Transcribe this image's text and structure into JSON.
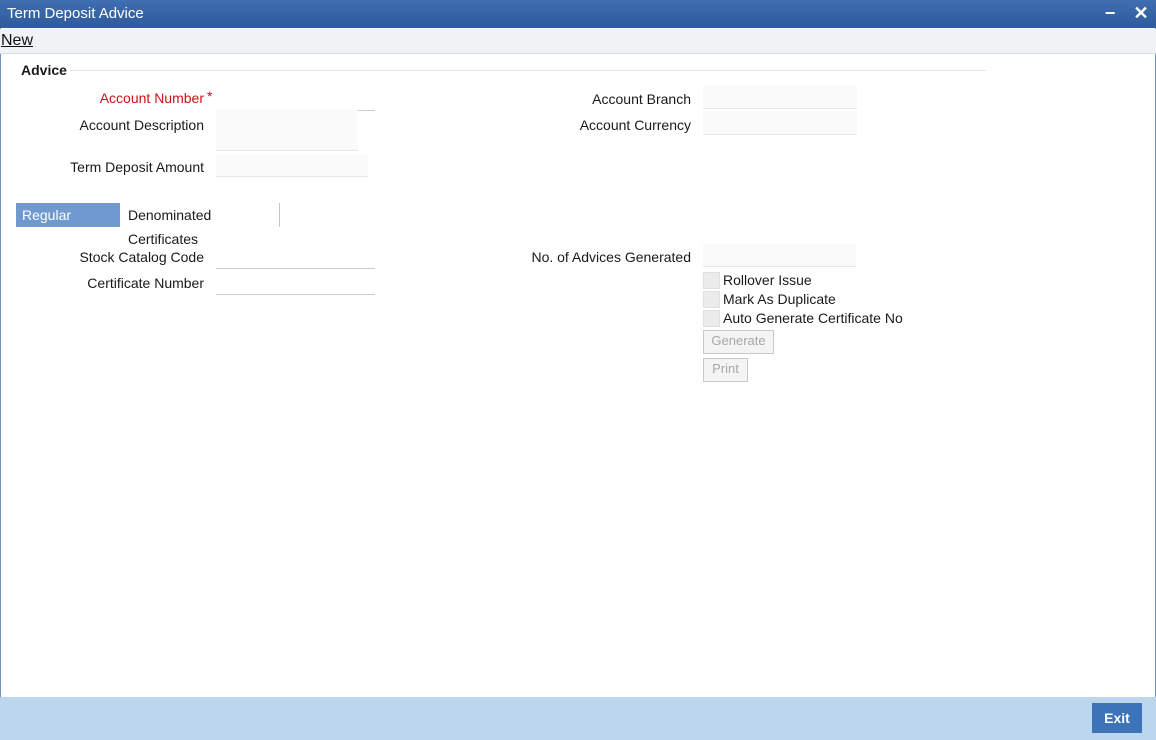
{
  "window": {
    "title": "Term Deposit Advice",
    "minimize_glyph": "−",
    "close_glyph": "✕"
  },
  "menu": {
    "new_label": "New"
  },
  "advice": {
    "section_title": "Advice",
    "account_number_label": "Account Number",
    "required_marker": "*",
    "account_description_label": "Account Description",
    "term_deposit_amount_label": "Term Deposit Amount",
    "account_branch_label": "Account Branch",
    "account_currency_label": "Account Currency"
  },
  "tabs": [
    {
      "label": "Regular Deposit",
      "active": true
    },
    {
      "label": "Denominated Certificates",
      "active": false
    }
  ],
  "regular": {
    "stock_catalog_code_label": "Stock Catalog Code",
    "certificate_number_label": "Certificate Number",
    "advices_generated_label": "No. of Advices Generated",
    "rollover_issue_label": "Rollover Issue",
    "mark_as_duplicate_label": "Mark As Duplicate",
    "auto_generate_label": "Auto Generate Certificate No",
    "generate_label": "Generate",
    "print_label": "Print"
  },
  "footer": {
    "exit_label": "Exit"
  },
  "colors": {
    "titlebar": "#2d5b9c",
    "active_tab": "#6f99cf",
    "footer": "#bcd6ee",
    "exit_button": "#3d73b8",
    "required": "#d0101a"
  }
}
